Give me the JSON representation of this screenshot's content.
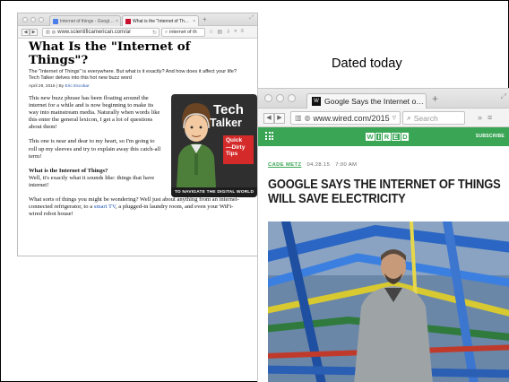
{
  "window1": {
    "tabs": [
      {
        "label": "Internet of things - Googl…",
        "close": "×"
      },
      {
        "label": "What is the \"Internet of Th…",
        "close": "×"
      }
    ],
    "new_tab": "+",
    "url": "www.scientificamerican.com/ar",
    "search": "internet of th",
    "article": {
      "title": "What Is the \"Internet of Things\"?",
      "dek": "The \"Internet of Things\" is everywhere. But what is it exactly? And how does it affect your life? Tech Talker delves into this hot new buzz word",
      "date": "April 29, 2015",
      "byline_prefix": "By",
      "author": "Eric Escobar",
      "p1": "This new buzz phrase has been floating around the internet for a while and is now beginning to make its way into mainstream media. Naturally when words like this enter the general lexicon, I get a lot of questions about them!",
      "p2": "This one is near and dear to my heart, so I'm going to roll up my sleeves and try to explain away this catch-all term!",
      "p3_heading": "What is the Internet of Things?",
      "p3": "Well, it's exactly what it sounds like: things that have internet!",
      "p4_a": "What sorts of things you might be wondering? Well just about anything from an internet-connected refrigerator, to a",
      "p4_link": "smart TV",
      "p4_b": ", a plugged-in laundry room, and even your WiFi-wired robot house!"
    },
    "promo": {
      "title_line1": "Tech",
      "title_line2": "Talker",
      "tips": "Quick\n—Dirty\nTips",
      "footer": "TO NAVIGATE THE DIGITAL WORLD"
    }
  },
  "caption": "Dated today",
  "window2": {
    "tabs": [
      {
        "label": "Google Says the Internet o…",
        "close": "×"
      }
    ],
    "new_tab": "+",
    "url": "www.wired.com/2015",
    "search": "Search",
    "site": {
      "logo": "WIRED",
      "subscribe": "SUBSCRIBE",
      "author": "CADE METZ",
      "date": "04.28.15",
      "time": "7:00 AM",
      "headline_line1": "GOOGLE SAYS THE INTERNET OF THINGS",
      "headline_line2": "WILL SAVE ELECTRICITY"
    }
  },
  "colors": {
    "wired_green": "#3aa655",
    "link_blue": "#1a56b5",
    "promo_red": "#d42a2a"
  }
}
